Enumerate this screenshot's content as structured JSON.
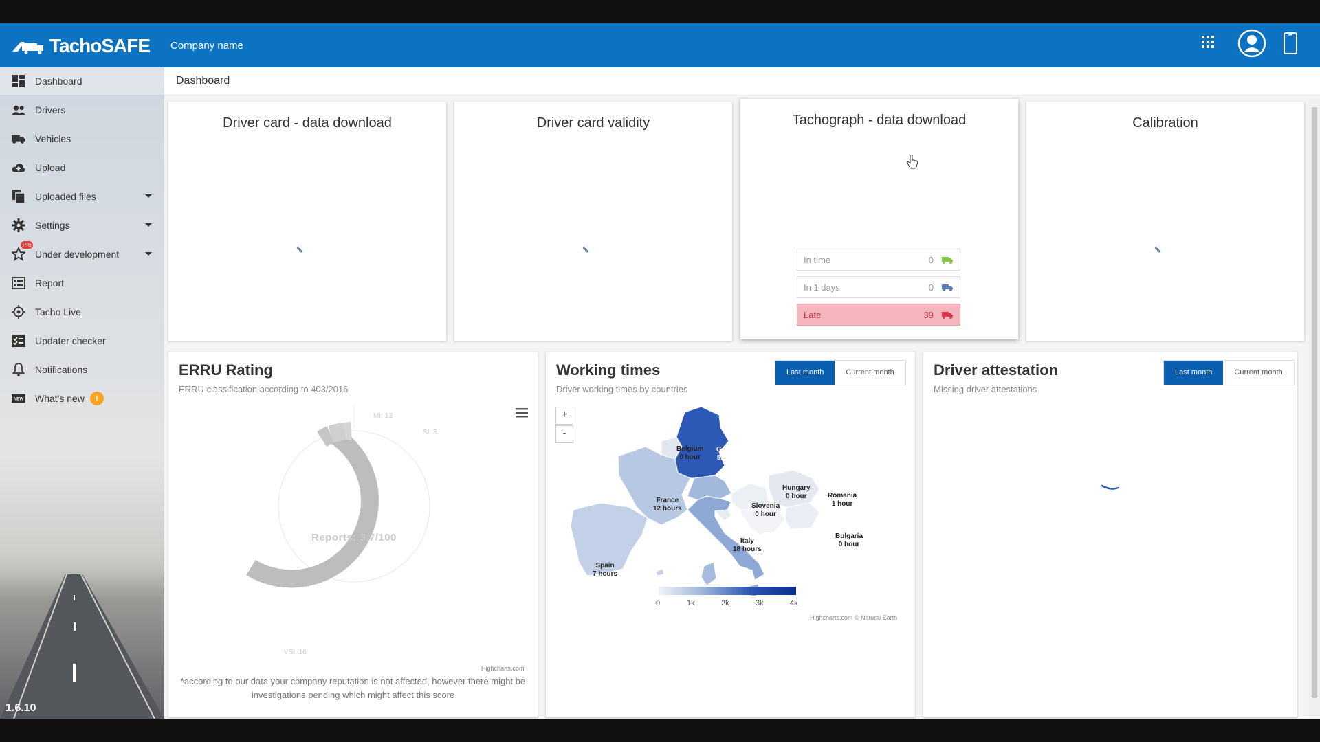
{
  "app": {
    "logo_text": "TachoSAFE",
    "company_name": "Company name",
    "version": "1.6.10"
  },
  "sidebar": {
    "items": [
      {
        "label": "Dashboard",
        "icon": "dashboard-icon"
      },
      {
        "label": "Drivers",
        "icon": "drivers-icon"
      },
      {
        "label": "Vehicles",
        "icon": "truck-icon"
      },
      {
        "label": "Upload",
        "icon": "cloud-upload-icon"
      },
      {
        "label": "Uploaded files",
        "icon": "files-icon"
      },
      {
        "label": "Settings",
        "icon": "gear-icon"
      },
      {
        "label": "Under development",
        "icon": "star-icon",
        "badge": "Pro"
      },
      {
        "label": "Report",
        "icon": "report-icon"
      },
      {
        "label": "Tacho Live",
        "icon": "target-icon"
      },
      {
        "label": "Updater checker",
        "icon": "checklist-icon"
      },
      {
        "label": "Notifications",
        "icon": "bell-icon"
      },
      {
        "label": "What's new",
        "icon": "new-icon",
        "badge": "!"
      }
    ]
  },
  "breadcrumb": "Dashboard",
  "cards": {
    "driver_card_download": "Driver card - data download",
    "driver_card_validity": "Driver card validity",
    "tachograph_download": "Tachograph - data download",
    "calibration": "Calibration"
  },
  "tachograph_status": [
    {
      "label": "In time",
      "count": "0",
      "color": "#8bc34a"
    },
    {
      "label": "In 1 days",
      "count": "0",
      "color": "#5c7fb8"
    },
    {
      "label": "Late",
      "count": "39",
      "color": "#d9364a"
    }
  ],
  "errru": {
    "title": "ERRU Rating",
    "subtitle": "ERRU classification according to 403/2016",
    "labels": [
      "MI: 13",
      "SI: 3",
      "VSI: 16"
    ],
    "center_label": "Reports: 3.7/100",
    "credit": "Highcharts.com",
    "footnote": "*according to our data your company reputation is not affected, however there might be investigations pending which might affect this score"
  },
  "working_times": {
    "title": "Working times",
    "subtitle": "Driver working times by countries",
    "btn_last": "Last month",
    "btn_current": "Current month",
    "zoom_in": "+",
    "zoom_out": "-",
    "countries": [
      {
        "name": "Germany",
        "value": "52 hours"
      },
      {
        "name": "Belgium",
        "value": "0 hour"
      },
      {
        "name": "France",
        "value": "12 hours"
      },
      {
        "name": "Hungary",
        "value": "0 hour"
      },
      {
        "name": "Romania",
        "value": "1 hour"
      },
      {
        "name": "Slovenia",
        "value": "0 hour"
      },
      {
        "name": "Italy",
        "value": "18 hours"
      },
      {
        "name": "Bulgaria",
        "value": "0 hour"
      },
      {
        "name": "Spain",
        "value": "7 hours"
      }
    ],
    "legend_ticks": [
      "0",
      "1k",
      "2k",
      "3k",
      "4k"
    ],
    "credit": "Highcharts.com © Natural Earth"
  },
  "driver_attestation": {
    "title": "Driver attestation",
    "subtitle": "Missing driver attestations",
    "btn_last": "Last month",
    "btn_current": "Current month"
  }
}
